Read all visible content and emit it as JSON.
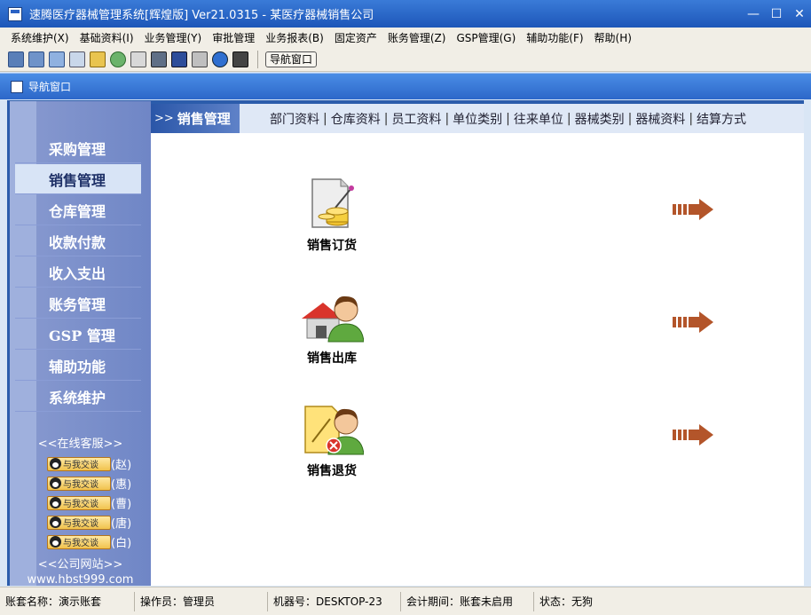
{
  "window": {
    "title": "速腾医疗器械管理系统[辉煌版] Ver21.0315  -  某医疗器械销售公司",
    "controls": {
      "minimize": "—",
      "maximize": "☐",
      "close": "✕"
    }
  },
  "menubar": [
    "系统维护(X)",
    "基础资料(I)",
    "业务管理(Y)",
    "审批管理",
    "业务报表(B)",
    "固定资产",
    "账务管理(Z)",
    "GSP管理(G)",
    "辅助功能(F)",
    "帮助(H)"
  ],
  "toolbar": {
    "icons": [
      "grid-icon",
      "table-icon",
      "windows-icon",
      "search-icon",
      "calendar-icon",
      "refresh-icon",
      "print-preview-icon",
      "inbox-icon",
      "save-icon",
      "printer-icon",
      "help-icon",
      "exit-icon"
    ],
    "nav_button": "导航窗口"
  },
  "navwindow": {
    "title": "导航窗口"
  },
  "sidebar": {
    "items": [
      "采购管理",
      "销售管理",
      "仓库管理",
      "收款付款",
      "收入支出",
      "账务管理",
      "GSP 管理",
      "辅助功能",
      "系统维护"
    ],
    "active_index": 1,
    "service_title": "<<在线客服>>",
    "chat_label": "与我交谈",
    "chat_agents": [
      "(赵)",
      "(惠)",
      "(曹)",
      "(唐)",
      "(白)"
    ],
    "website_title": "<<公司网站>>",
    "website_url": "www.hbst999.com"
  },
  "content": {
    "current_prefix": ">>",
    "current_title": "销售管理",
    "quicklinks": [
      "部门资料",
      "仓库资料",
      "员工资料",
      "单位类别",
      "往来单位",
      "器械类别",
      "器械资料",
      "结算方式"
    ],
    "actions": [
      {
        "label": "销售订货",
        "icon": "sales-order-icon"
      },
      {
        "label": "销售出库",
        "icon": "sales-outbound-icon"
      },
      {
        "label": "销售退货",
        "icon": "sales-return-icon"
      }
    ]
  },
  "statusbar": {
    "account": "账套名称：演示账套",
    "operator": "操作员：管理员",
    "machine": "机器号：DESKTOP-23",
    "period": "会计期间：账套未启用",
    "state": "状态：无狗"
  },
  "colors": {
    "title_blue": "#1d56b8",
    "sidebar": "#7b8fcc",
    "active_bg": "#d8e4f6",
    "arrow": "#b3552a"
  }
}
